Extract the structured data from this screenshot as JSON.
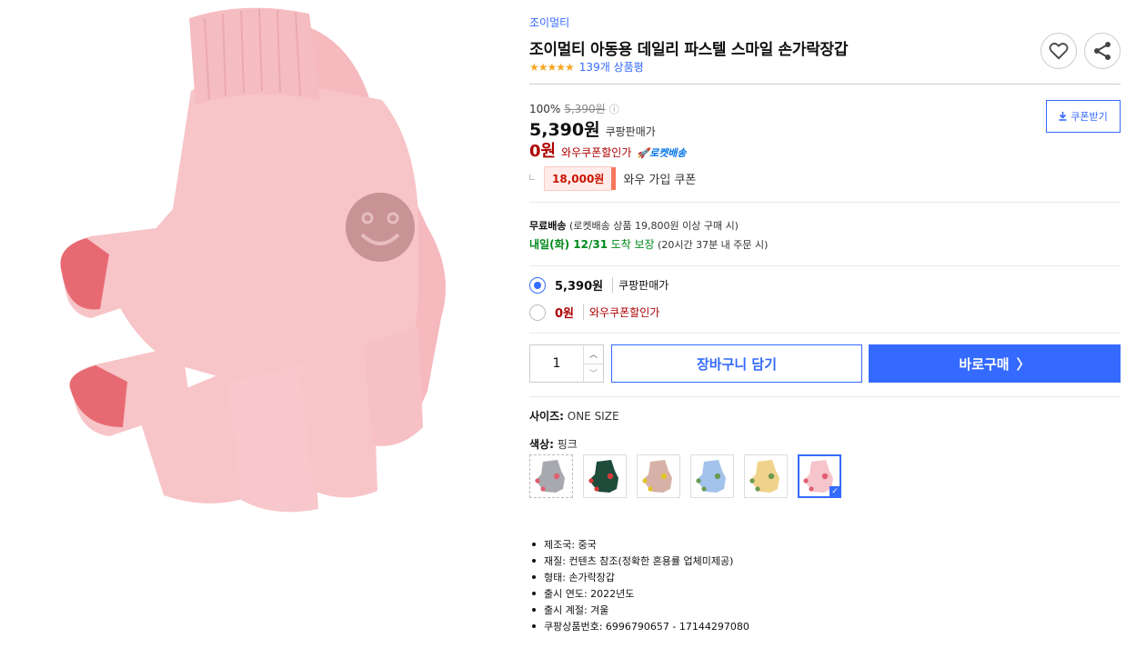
{
  "product": {
    "brand": "조이멀티",
    "title": "조이멀티 아동용 데일리 파스텔 스마일 손가락장갑",
    "stars": "★★★★★",
    "review_count": "139개 상품평"
  },
  "pricing": {
    "discount_rate": "100%",
    "original_price": "5,390원",
    "info_icon": "ⓘ",
    "price": "5,390원",
    "price_label": "쿠팡판매가",
    "wow_price": "0원",
    "wow_label": "와우쿠폰할인가",
    "rocket_label": "🚀로켓배송",
    "coupon_button": "쿠폰받기",
    "member_coupon_amount": "18,000원",
    "member_coupon_label": "와우 가입 쿠폰"
  },
  "shipping": {
    "free_label": "무료배송",
    "free_condition": "(로켓배송 상품 19,800원 이상 구매 시)",
    "arrival": "내일(화) 12/31",
    "arrival_label": "도착 보장",
    "deadline": "(20시간 37분 내 주문 시)"
  },
  "options": [
    {
      "amount": "5,390원",
      "label": "쿠팡판매가",
      "selected": true
    },
    {
      "amount": "0원",
      "label": "와우쿠폰할인가",
      "selected": false
    }
  ],
  "purchase": {
    "quantity": "1",
    "up_arrow": "︿",
    "down_arrow": "﹀",
    "cart_button": "장바구니 담기",
    "buy_button": "바로구매",
    "buy_chevron": "〉"
  },
  "attributes": {
    "size_label": "사이즈:",
    "size_value": "ONE SIZE",
    "color_label": "색상:",
    "color_value": "핑크"
  },
  "swatches": [
    {
      "color": "#a7a9ae",
      "accent": "#e05f72",
      "state": "soldout"
    },
    {
      "color": "#1f4b3a",
      "accent": "#d93a3a",
      "state": "normal"
    },
    {
      "color": "#d7b1a8",
      "accent": "#e3c32b",
      "state": "normal"
    },
    {
      "color": "#a3c3ec",
      "accent": "#6a9a52",
      "state": "normal"
    },
    {
      "color": "#f1d28b",
      "accent": "#6a9a52",
      "state": "normal"
    },
    {
      "color": "#f6c4cb",
      "accent": "#e05f72",
      "state": "selected"
    }
  ],
  "specs": [
    "제조국: 중국",
    "재질: 컨텐츠 참조(정확한 혼용률 업체미제공)",
    "형태: 손가락장갑",
    "출시 연도: 2022년도",
    "출시 계절: 겨울",
    "쿠팡상품번호: 6996790657 - 17144297080"
  ],
  "colors": {
    "accent": "#346aff",
    "wow_red": "#ae0000",
    "arrival_green": "#00891a",
    "star": "#f5a623",
    "glove_main": "#f7c4c8",
    "glove_tip": "#e76a72",
    "smiley_badge": "#c99395"
  },
  "icons": {
    "wish": "heart-icon",
    "share": "share-icon",
    "coupon": "download-icon",
    "info": "info-icon"
  }
}
